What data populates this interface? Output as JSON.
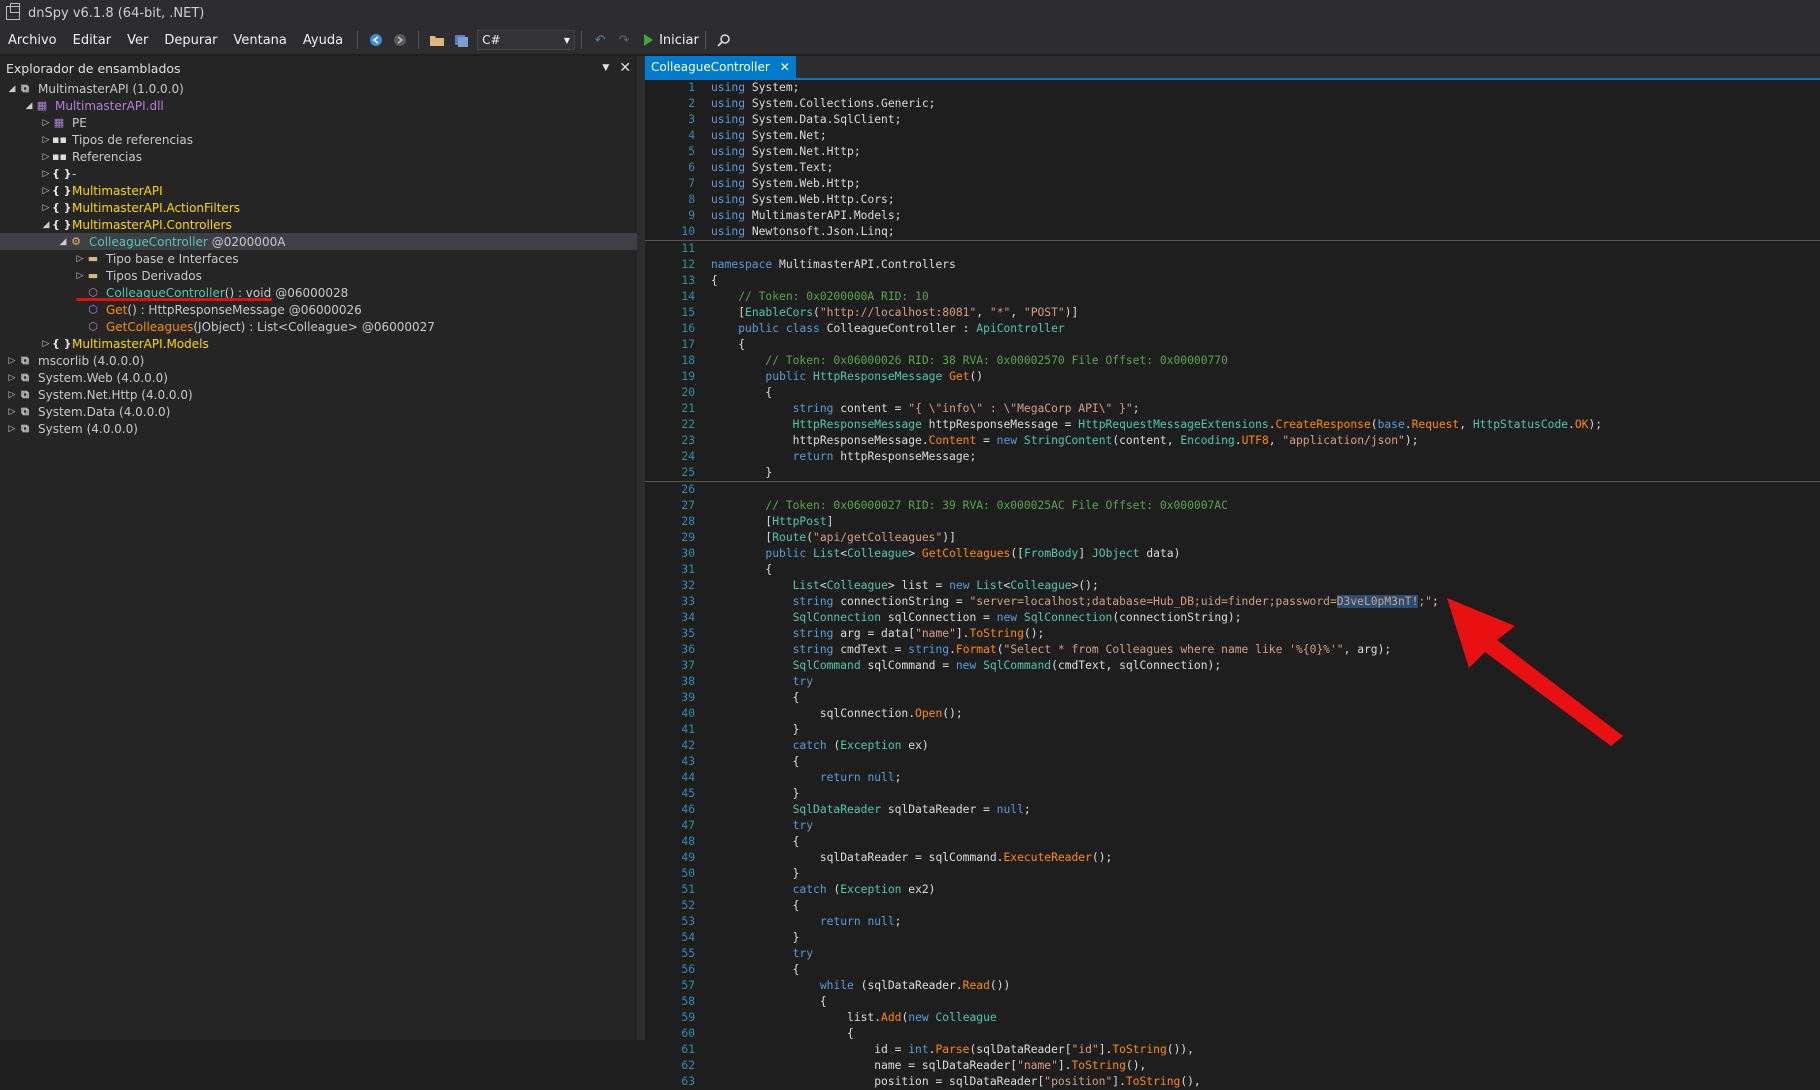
{
  "window": {
    "title": "dnSpy v6.1.8 (64-bit, .NET)"
  },
  "menu": [
    "Archivo",
    "Editar",
    "Ver",
    "Depurar",
    "Ventana",
    "Ayuda"
  ],
  "toolbar": {
    "language": "C#",
    "run_label": "Iniciar"
  },
  "explorer": {
    "title": "Explorador de ensamblados",
    "rows": [
      {
        "depth": 0,
        "exp": "open",
        "icon": "asm",
        "text": "MultimasterAPI (1.0.0.0)",
        "cls": "t-gray"
      },
      {
        "depth": 1,
        "exp": "open",
        "icon": "dll",
        "text": "MultimasterAPI.dll",
        "cls": "t-purple"
      },
      {
        "depth": 2,
        "exp": "closed",
        "icon": "dll",
        "text": "PE",
        "cls": "t-gray"
      },
      {
        "depth": 2,
        "exp": "closed",
        "icon": "ref",
        "text": "Tipos de referencias",
        "cls": "t-gray"
      },
      {
        "depth": 2,
        "exp": "closed",
        "icon": "ref",
        "text": "Referencias",
        "cls": "t-gray"
      },
      {
        "depth": 2,
        "exp": "closed",
        "icon": "ns",
        "text": "-",
        "cls": "t-gray"
      },
      {
        "depth": 2,
        "exp": "closed",
        "icon": "ns",
        "text": "MultimasterAPI",
        "cls": "t-yellow"
      },
      {
        "depth": 2,
        "exp": "closed",
        "icon": "ns",
        "text": "MultimasterAPI.ActionFilters",
        "cls": "t-yellow"
      },
      {
        "depth": 2,
        "exp": "open",
        "icon": "ns",
        "text": "MultimasterAPI.Controllers",
        "cls": "t-yellow"
      },
      {
        "depth": 3,
        "exp": "open",
        "icon": "cls",
        "text": "ColleagueController",
        "token": "@0200000A",
        "cls": "t-teal",
        "selected": true
      },
      {
        "depth": 4,
        "exp": "closed",
        "icon": "folder",
        "text": "Tipo base e Interfaces",
        "cls": "t-gray"
      },
      {
        "depth": 4,
        "exp": "closed",
        "icon": "folder",
        "text": "Tipos Derivados",
        "cls": "t-gray"
      },
      {
        "depth": 4,
        "exp": "none",
        "icon": "method",
        "text": "ColleagueController",
        "sig": "() : void",
        "token": "@06000028",
        "cls": "t-teal"
      },
      {
        "depth": 4,
        "exp": "none",
        "icon": "method",
        "text": "Get",
        "sig": "() : HttpResponseMessage",
        "token": "@06000026",
        "cls": "t-orange"
      },
      {
        "depth": 4,
        "exp": "none",
        "icon": "method",
        "text": "GetColleagues",
        "sig": "(JObject) : List<Colleague>",
        "token": "@06000027",
        "cls": "t-orange"
      },
      {
        "depth": 2,
        "exp": "closed",
        "icon": "ns",
        "text": "MultimasterAPI.Models",
        "cls": "t-yellow"
      },
      {
        "depth": 0,
        "exp": "closed",
        "icon": "asm",
        "text": "mscorlib (4.0.0.0)",
        "cls": "t-gray"
      },
      {
        "depth": 0,
        "exp": "closed",
        "icon": "asm",
        "text": "System.Web (4.0.0.0)",
        "cls": "t-gray"
      },
      {
        "depth": 0,
        "exp": "closed",
        "icon": "asm",
        "text": "System.Net.Http (4.0.0.0)",
        "cls": "t-gray"
      },
      {
        "depth": 0,
        "exp": "closed",
        "icon": "asm",
        "text": "System.Data (4.0.0.0)",
        "cls": "t-gray"
      },
      {
        "depth": 0,
        "exp": "closed",
        "icon": "asm",
        "text": "System (4.0.0.0)",
        "cls": "t-gray"
      }
    ]
  },
  "editor": {
    "tab": "ColleagueController",
    "lines": [
      "using System;",
      "using System.Collections.Generic;",
      "using System.Data.SqlClient;",
      "using System.Net;",
      "using System.Net.Http;",
      "using System.Text;",
      "using System.Web.Http;",
      "using System.Web.Http.Cors;",
      "using MultimasterAPI.Models;",
      "using Newtonsoft.Json.Linq;",
      "",
      "namespace MultimasterAPI.Controllers",
      "{",
      "    // Token: 0x0200000A RID: 10",
      "    [EnableCors(\"http://localhost:8081\", \"*\", \"POST\")]",
      "    public class ColleagueController : ApiController",
      "    {",
      "        // Token: 0x06000026 RID: 38 RVA: 0x00002570 File Offset: 0x00000770",
      "        public HttpResponseMessage Get()",
      "        {",
      "            string content = \"{ \\\"info\\\" : \\\"MegaCorp API\\\" }\";",
      "            HttpResponseMessage httpResponseMessage = HttpRequestMessageExtensions.CreateResponse(base.Request, HttpStatusCode.OK);",
      "            httpResponseMessage.Content = new StringContent(content, Encoding.UTF8, \"application/json\");",
      "            return httpResponseMessage;",
      "        }",
      "",
      "        // Token: 0x06000027 RID: 39 RVA: 0x000025AC File Offset: 0x000007AC",
      "        [HttpPost]",
      "        [Route(\"api/getColleagues\")]",
      "        public List<Colleague> GetColleagues([FromBody] JObject data)",
      "        {",
      "            List<Colleague> list = new List<Colleague>();",
      "            string connectionString = \"server=localhost;database=Hub_DB;uid=finder;password=D3veL0pM3nT!;\";",
      "            SqlConnection sqlConnection = new SqlConnection(connectionString);",
      "            string arg = data[\"name\"].ToString();",
      "            string cmdText = string.Format(\"Select * from Colleagues where name like '%{0}%'\", arg);",
      "            SqlCommand sqlCommand = new SqlCommand(cmdText, sqlConnection);",
      "            try",
      "            {",
      "                sqlConnection.Open();",
      "            }",
      "            catch (Exception ex)",
      "            {",
      "                return null;",
      "            }",
      "            SqlDataReader sqlDataReader = null;",
      "            try",
      "            {",
      "                sqlDataReader = sqlCommand.ExecuteReader();",
      "            }",
      "            catch (Exception ex2)",
      "            {",
      "                return null;",
      "            }",
      "            try",
      "            {",
      "                while (sqlDataReader.Read())",
      "                {",
      "                    list.Add(new Colleague",
      "                    {",
      "                        id = int.Parse(sqlDataReader[\"id\"].ToString()),",
      "                        name = sqlDataReader[\"name\"].ToString(),",
      "                        position = sqlDataReader[\"position\"].ToString(),"
    ],
    "highlight": "D3veL0pM3nT!"
  },
  "colors": {
    "accent": "#007acc",
    "annotation": "#e01010"
  }
}
